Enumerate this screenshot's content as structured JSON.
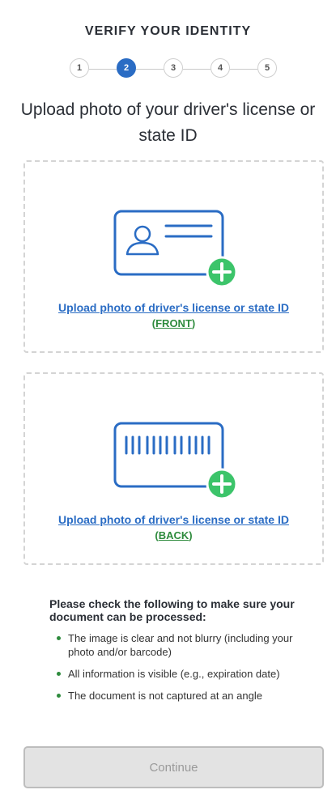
{
  "header": {
    "title": "VERIFY YOUR IDENTITY"
  },
  "stepper": {
    "steps": [
      "1",
      "2",
      "3",
      "4",
      "5"
    ],
    "active_step": "2"
  },
  "main": {
    "title": "Upload photo of your driver's license or state ID",
    "front_upload": {
      "link_label": "Upload photo of driver's license or state ID",
      "side_open": "(",
      "side_label": "FRONT",
      "side_close": ")",
      "icon": "id-card-front-icon"
    },
    "back_upload": {
      "link_label": "Upload photo of driver's license or state ID",
      "side_open": "(",
      "side_label": "BACK",
      "side_close": ")",
      "icon": "id-card-barcode-icon"
    }
  },
  "checklist": {
    "heading": "Please check the following to make sure your document can be processed:",
    "items": [
      "The image is clear and not blurry (including your photo and/or barcode)",
      "All information is visible (e.g., expiration date)",
      "The document is not captured at an angle"
    ]
  },
  "footer": {
    "continue_label": "Continue"
  },
  "colors": {
    "accent": "#2a6cc4",
    "success": "#2e8b3d",
    "add_badge": "#3cc46a",
    "disabled_button": "#e3e3e3"
  }
}
